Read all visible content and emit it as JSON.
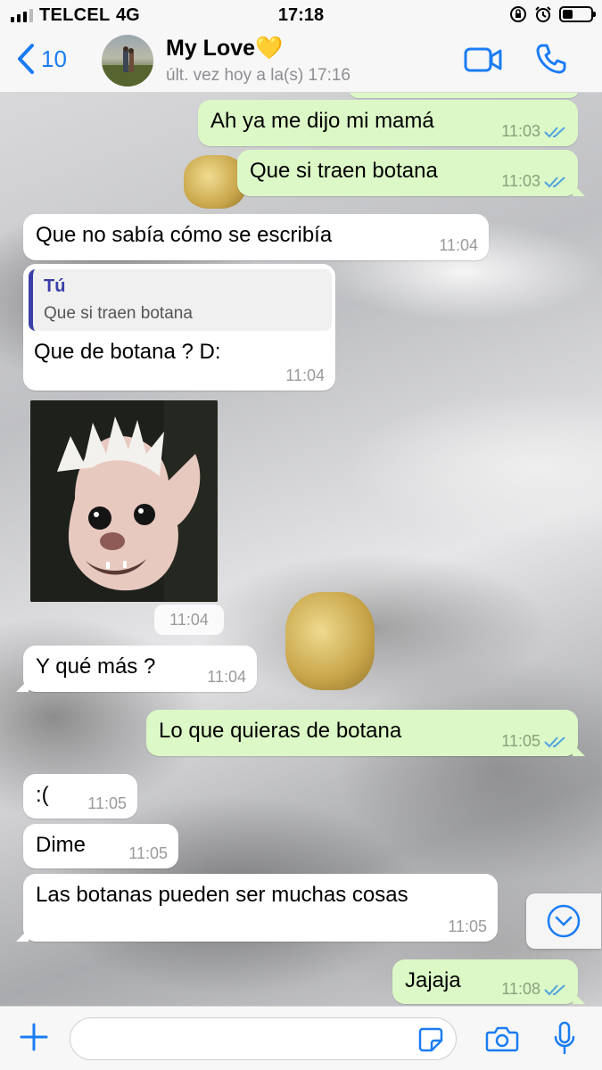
{
  "status_bar": {
    "carrier": "TELCEL",
    "network": "4G",
    "time": "17:18"
  },
  "header": {
    "back_count": "10",
    "contact_name": "My Love💛",
    "contact_status": "últ. vez hoy a la(s) 17:16"
  },
  "messages": [
    {
      "dir": "out",
      "text": "Ah ya me dijo mi mamá",
      "time": "11:03",
      "read": true
    },
    {
      "dir": "out",
      "text": "Que si traen botana",
      "time": "11:03",
      "read": true
    },
    {
      "dir": "in",
      "text": "Que no sabía cómo se escribía",
      "time": "11:04"
    },
    {
      "dir": "in",
      "text": "Que de botana ? D:",
      "time": "11:04",
      "quote": {
        "author": "Tú",
        "text": "Que si traen botana"
      }
    },
    {
      "dir": "in",
      "type": "image",
      "time": "11:04"
    },
    {
      "dir": "in",
      "text": "Y qué más ?",
      "time": "11:04"
    },
    {
      "dir": "out",
      "text": "Lo que quieras de botana",
      "time": "11:05",
      "read": true
    },
    {
      "dir": "in",
      "text": ":(",
      "time": "11:05"
    },
    {
      "dir": "in",
      "text": "Dime",
      "time": "11:05"
    },
    {
      "dir": "in",
      "text": "Las botanas pueden ser muchas cosas",
      "time": "11:05"
    },
    {
      "dir": "out",
      "text": "Jajaja",
      "time": "11:08",
      "read": true
    }
  ],
  "colors": {
    "accent": "#1a7cf3",
    "outgoing_bubble": "#dcf8c6",
    "incoming_bubble": "#ffffff",
    "read_ticks": "#4fa3e0"
  },
  "icons": [
    "back-chevron-icon",
    "video-call-icon",
    "phone-icon",
    "scroll-down-icon",
    "plus-icon",
    "sticker-icon",
    "camera-icon",
    "mic-icon",
    "lock-rotation-icon",
    "alarm-icon",
    "battery-icon",
    "signal-icon"
  ],
  "composer": {
    "placeholder": ""
  }
}
